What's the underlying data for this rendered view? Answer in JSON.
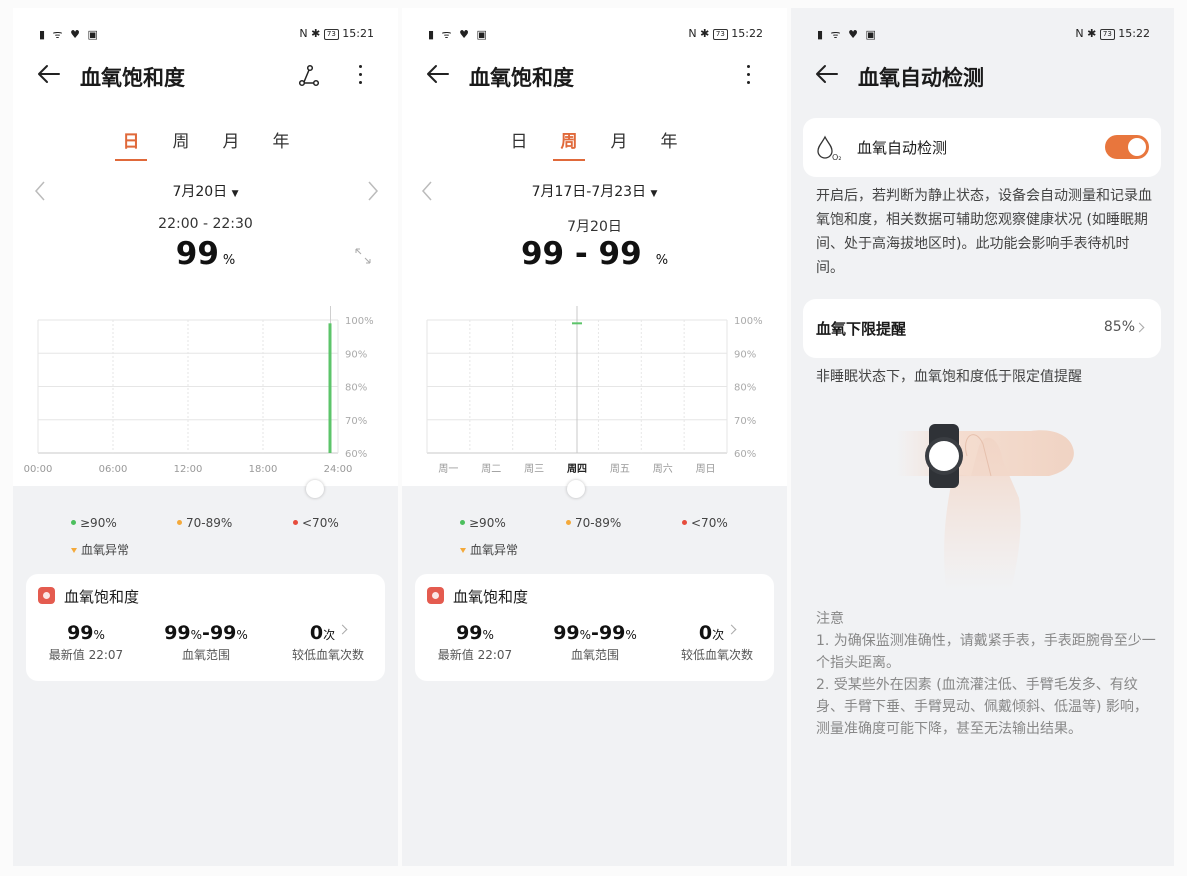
{
  "status": {
    "p1_time": "15:21",
    "p2_time": "15:22",
    "p3_time": "15:22",
    "battery": "73"
  },
  "day": {
    "title": "血氧饱和度",
    "tabs": [
      "日",
      "周",
      "月",
      "年"
    ],
    "date": "7月20日",
    "time_range": "22:00 - 22:30",
    "value": "99",
    "unit": "%"
  },
  "week": {
    "title": "血氧饱和度",
    "tabs": [
      "日",
      "周",
      "月",
      "年"
    ],
    "date": "7月17日-7月23日",
    "sub_date": "7月20日",
    "value": "99 - 99",
    "unit": "%"
  },
  "chart_data": [
    {
      "type": "bar",
      "x": [
        "00:00",
        "06:00",
        "12:00",
        "18:00",
        "24:00"
      ],
      "y_ticks": [
        "100%",
        "90%",
        "80%",
        "70%",
        "60%"
      ],
      "ylim": [
        60,
        100
      ],
      "series": [
        {
          "values": [
            {
              "x": "22:00",
              "low": 60,
              "high": 99
            }
          ]
        }
      ]
    },
    {
      "type": "bar",
      "x": [
        "周一",
        "周二",
        "周三",
        "周四",
        "周五",
        "周六",
        "周日"
      ],
      "y_ticks": [
        "100%",
        "90%",
        "80%",
        "70%",
        "60%"
      ],
      "ylim": [
        60,
        100
      ],
      "highlight": "周四",
      "series": [
        {
          "values": [
            {
              "x": "周四",
              "low": 99,
              "high": 99
            }
          ]
        }
      ]
    }
  ],
  "legend": {
    "high": "≥90%",
    "mid": "70-89%",
    "low": "<70%",
    "abnormal": "血氧异常",
    "colors": {
      "high": "#4cbf5d",
      "mid": "#f4a93a",
      "low": "#e64c3c"
    }
  },
  "summary": {
    "title": "血氧饱和度",
    "latest_value": "99",
    "latest_unit": "%",
    "latest_label": "最新值 22:07",
    "range_a": "99",
    "range_b": "99",
    "range_unit": "%",
    "range_dash": "-",
    "range_label": "血氧范围",
    "low_count": "0",
    "low_unit": "次",
    "low_label": "较低血氧次数"
  },
  "auto": {
    "title": "血氧自动检测",
    "switch_label": "血氧自动检测",
    "switch_on": true,
    "description": "开启后，若判断为静止状态，设备会自动测量和记录血氧饱和度，相关数据可辅助您观察健康状况 (如睡眠期间、处于高海拔地区时)。此功能会影响手表待机时间。",
    "limit_label": "血氧下限提醒",
    "limit_value": "85%",
    "limit_desc": "非睡眠状态下，血氧饱和度低于限定值提醒",
    "note_title": "注意",
    "note_1": "1. 为确保监测准确性，请戴紧手表，手表距腕骨至少一个指头距离。",
    "note_2": "2. 受某些外在因素 (血流灌注低、手臂毛发多、有纹身、手臂下垂、手臂晃动、佩戴倾斜、低温等) 影响，测量准确度可能下降，甚至无法输出结果。"
  },
  "accent": "#e0693a"
}
